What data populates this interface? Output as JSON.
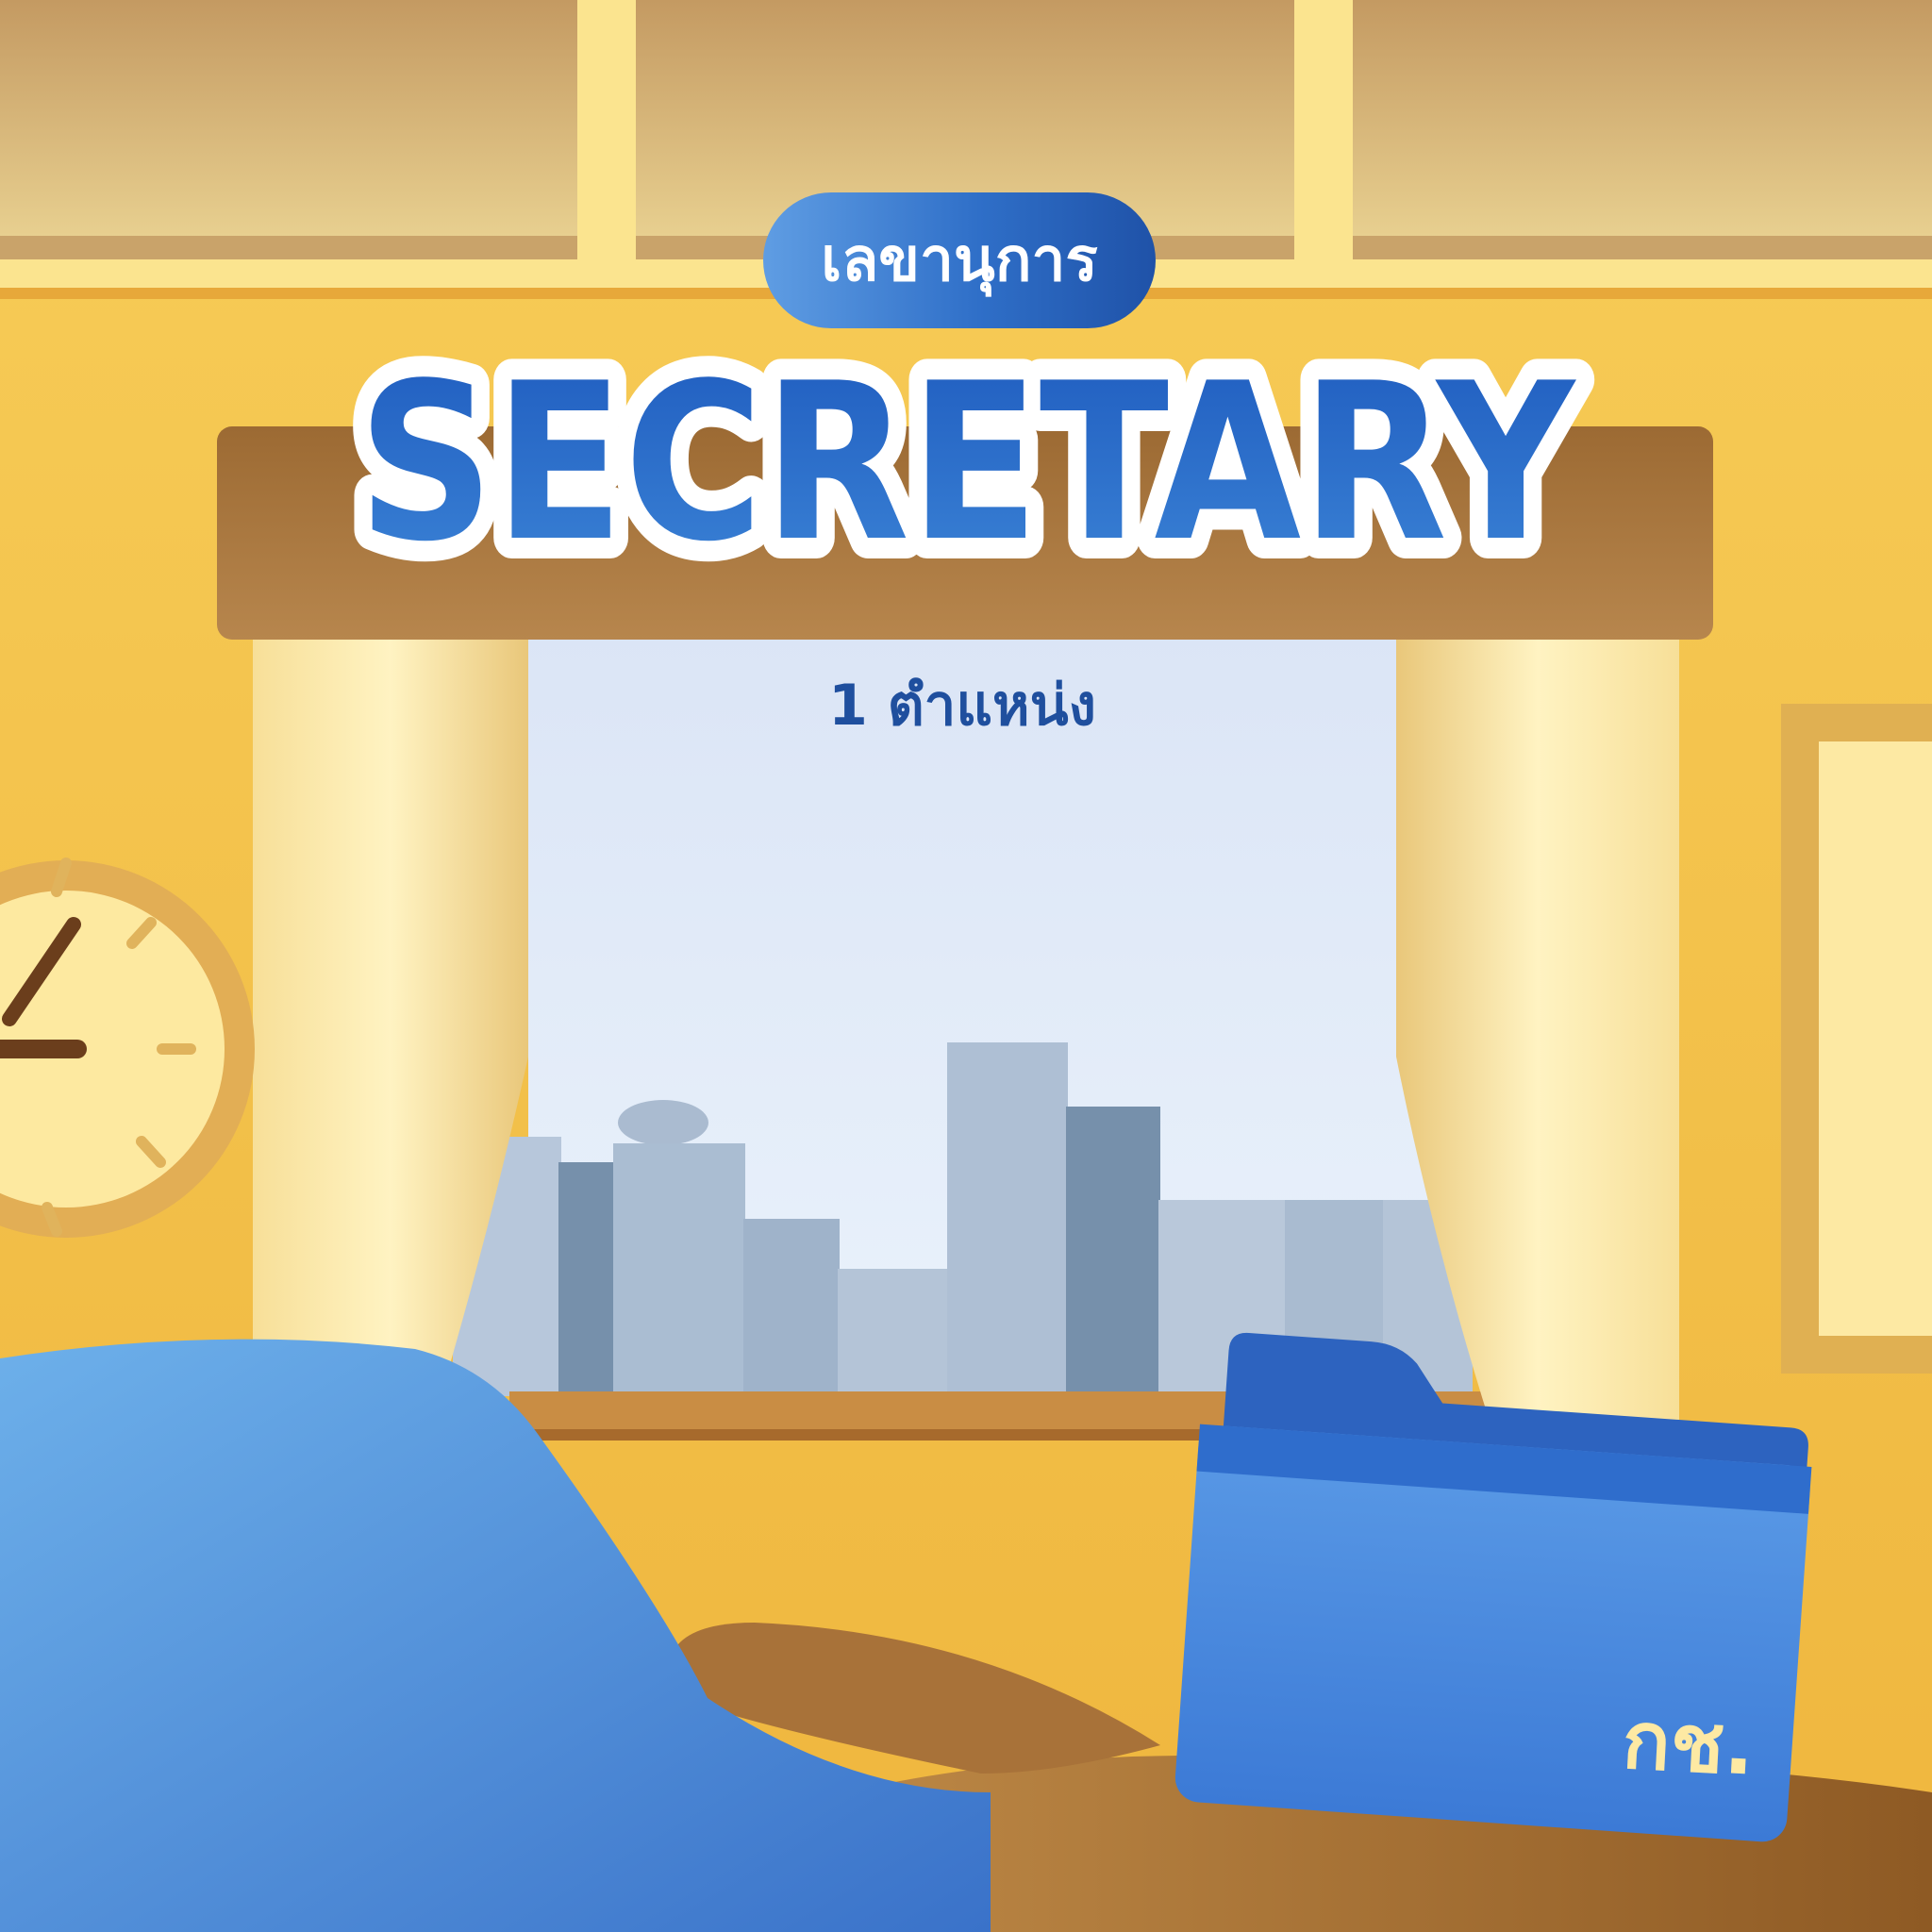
{
  "badge": {
    "text": "เลขานุการ"
  },
  "headline": {
    "text": "SECRETARY"
  },
  "subheadline": {
    "text": "1 ตำแหน่ง"
  },
  "folder": {
    "label": "กช."
  },
  "colors": {
    "wall": "#f5c24a",
    "ceiling": "#e7d08a",
    "beam": "#fbe48f",
    "valance": "#a8753b",
    "sky": "#e3ecf8",
    "building_light": "#aebfd4",
    "building_dark": "#7490aa",
    "sofa": "#4f8fdc",
    "folder": "#4a8ae0",
    "headline_blue": "#2563c4",
    "badge_blue": "#2f6fc8"
  }
}
